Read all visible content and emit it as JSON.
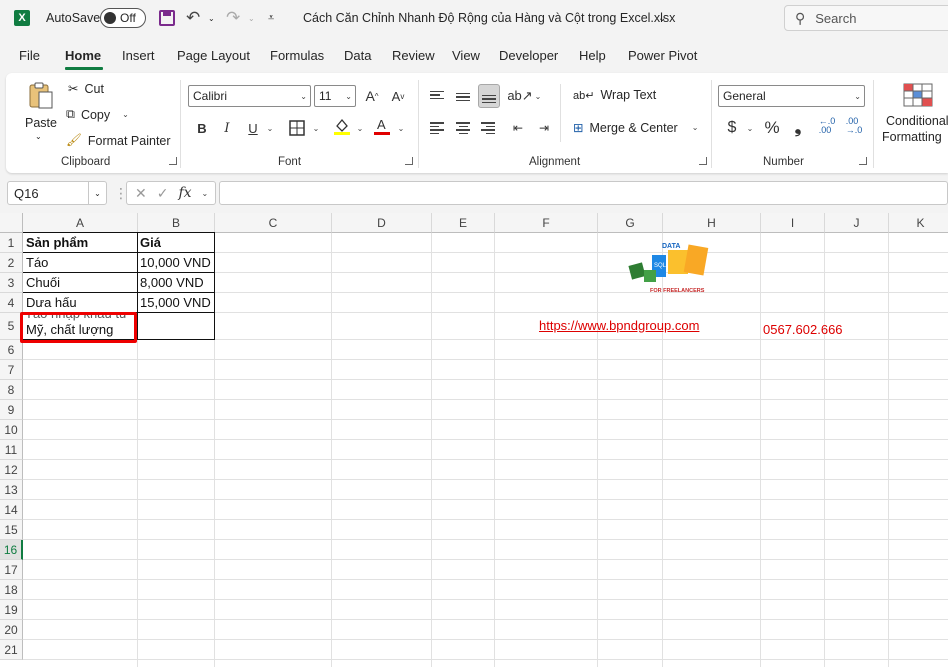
{
  "titlebar": {
    "autosave_label": "AutoSave",
    "autosave_state": "Off",
    "file_title": "Cách Căn Chỉnh Nhanh Độ Rộng của Hàng và Cột trong Excel.xlsx",
    "search_placeholder": "Search"
  },
  "menu": {
    "items": [
      "File",
      "Home",
      "Insert",
      "Page Layout",
      "Formulas",
      "Data",
      "Review",
      "View",
      "Developer",
      "Help",
      "Power Pivot"
    ],
    "active": "Home"
  },
  "ribbon": {
    "clipboard": {
      "paste": "Paste",
      "cut": "Cut",
      "copy": "Copy",
      "format_painter": "Format Painter",
      "label": "Clipboard"
    },
    "font": {
      "font_name": "Calibri",
      "font_size": "11",
      "bold": "B",
      "italic": "I",
      "underline": "U",
      "label": "Font"
    },
    "alignment": {
      "wrap_text": "Wrap Text",
      "merge_center": "Merge & Center",
      "label": "Alignment"
    },
    "number": {
      "format": "General",
      "currency": "$",
      "percent": "%",
      "comma": "❟",
      "inc_decimal": "←.0\n.00",
      "dec_decimal": ".00\n→.0",
      "label": "Number"
    },
    "styles": {
      "conditional_1": "Conditional",
      "conditional_2": "Formatting"
    }
  },
  "formula_bar": {
    "name_box": "Q16",
    "fx": "fx",
    "value": ""
  },
  "columns": [
    "A",
    "B",
    "C",
    "D",
    "E",
    "F",
    "G",
    "H",
    "I",
    "J",
    "K"
  ],
  "rows": [
    "1",
    "2",
    "3",
    "4",
    "5",
    "6",
    "7",
    "8",
    "9",
    "10",
    "11",
    "12",
    "13",
    "14",
    "15",
    "16",
    "17",
    "18",
    "19",
    "20",
    "21"
  ],
  "selected_row": "16",
  "cells": {
    "A1": "Sản phẩm",
    "B1": "Giá",
    "A2": "Táo",
    "B2": "10,000 VND",
    "A3": "Chuối",
    "B3": "8,000 VND",
    "A4": "Dưa hấu",
    "B4": "15,000 VND",
    "A5_clipped": "Táo nhập khẩu từ",
    "A5": "Mỹ, chất lượng"
  },
  "sheet_extras": {
    "website": "https://www.bpndgroup.com",
    "phone": "0567.602.666",
    "logo_data": "DATA",
    "logo_sql": "SQL",
    "logo_freelancers": "FOR FREELANCERS"
  },
  "colors": {
    "excel_green": "#107c41",
    "link_red": "#d00000",
    "highlight_box": "#e00000"
  }
}
